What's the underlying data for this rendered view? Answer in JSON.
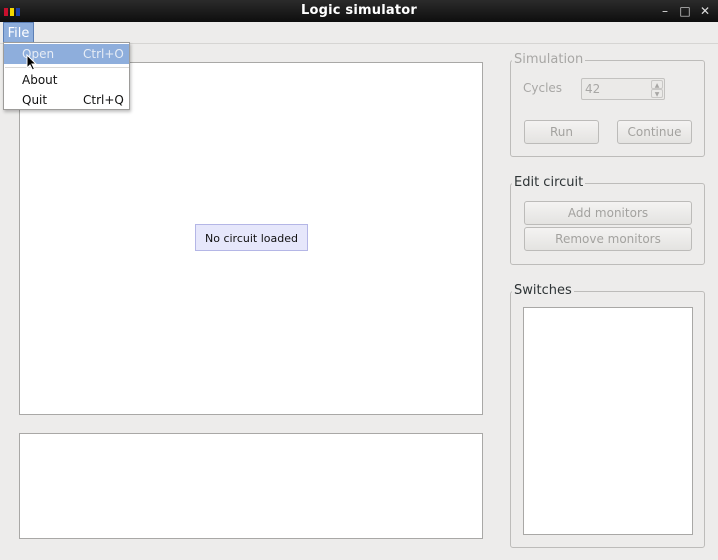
{
  "window": {
    "title": "Logic simulator",
    "controls": {
      "minimize": "–",
      "maximize": "□",
      "close": "✕"
    }
  },
  "menubar": {
    "file_label": "File"
  },
  "file_menu": {
    "items": [
      {
        "label": "Open",
        "shortcut": "Ctrl+O",
        "highlighted": true
      },
      {
        "label": "About",
        "shortcut": ""
      },
      {
        "label": "Quit",
        "shortcut": "Ctrl+Q"
      }
    ]
  },
  "canvas": {
    "status_text": "No circuit loaded"
  },
  "simulation": {
    "title": "Simulation",
    "cycles_label": "Cycles",
    "cycles_value": "42",
    "run_label": "Run",
    "continue_label": "Continue"
  },
  "edit_circuit": {
    "title": "Edit circuit",
    "add_monitors_label": "Add monitors",
    "remove_monitors_label": "Remove monitors"
  },
  "switches": {
    "title": "Switches"
  },
  "colors": {
    "highlight": "#8eaedc",
    "panel": "#edeceb",
    "status_bg": "#e6e7fb"
  }
}
